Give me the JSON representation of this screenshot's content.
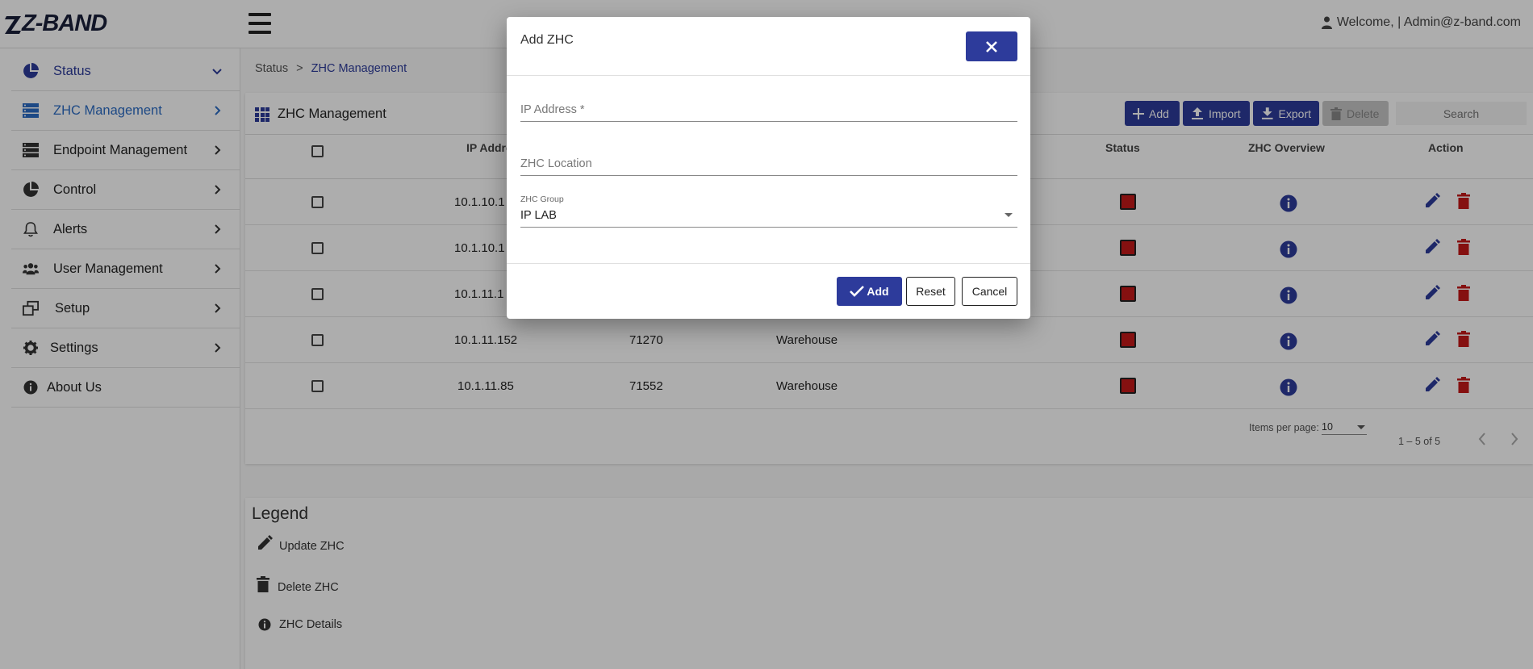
{
  "header": {
    "logo_text": "Z-BAND",
    "welcome": "Welcome, | Admin@z-band.com"
  },
  "sidebar": {
    "items": [
      {
        "label": "Status",
        "icon": "pie-chart-icon"
      },
      {
        "label": "ZHC Management",
        "icon": "server-icon"
      },
      {
        "label": "Endpoint Management",
        "icon": "server-icon"
      },
      {
        "label": "Control",
        "icon": "pie-chart-icon"
      },
      {
        "label": "Alerts",
        "icon": "bell-icon"
      },
      {
        "label": "User Management",
        "icon": "users-icon"
      },
      {
        "label": "Setup",
        "icon": "windows-icon"
      },
      {
        "label": "Settings",
        "icon": "gear-icon"
      },
      {
        "label": "About Us",
        "icon": "info-icon"
      }
    ]
  },
  "breadcrumb": {
    "parent": "Status",
    "separator": ">",
    "current": "ZHC Management"
  },
  "card": {
    "title": "ZHC Management",
    "add_label": "Add",
    "import_label": "Import",
    "export_label": "Export",
    "delete_label": "Delete",
    "search_placeholder": "Search"
  },
  "table": {
    "headers": {
      "ip": "IP Addre",
      "status": "Status",
      "overview": "ZHC Overview",
      "action": "Action"
    },
    "rows": [
      {
        "ip": "10.1.10.1",
        "id": "",
        "location": ""
      },
      {
        "ip": "10.1.10.1",
        "id": "",
        "location": ""
      },
      {
        "ip": "10.1.11.1",
        "id": "",
        "location": ""
      },
      {
        "ip": "10.1.11.152",
        "id": "71270",
        "location": "Warehouse"
      },
      {
        "ip": "10.1.11.85",
        "id": "71552",
        "location": "Warehouse"
      }
    ]
  },
  "pager": {
    "items_label": "Items per page:",
    "page_size": "10",
    "range": "1 – 5 of 5"
  },
  "legend": {
    "title": "Legend",
    "update": "Update ZHC",
    "delete": "Delete ZHC",
    "details": "ZHC Details"
  },
  "dialog": {
    "title": "Add ZHC",
    "ip_placeholder": "IP Address *",
    "location_placeholder": "ZHC Location",
    "group_label": "ZHC Group",
    "group_value": "IP LAB",
    "add_label": "Add",
    "reset_label": "Reset",
    "cancel_label": "Cancel"
  },
  "colors": {
    "primary": "#2d3b9b",
    "active_nav": "#2b6cc4",
    "status_red": "#c41818"
  }
}
